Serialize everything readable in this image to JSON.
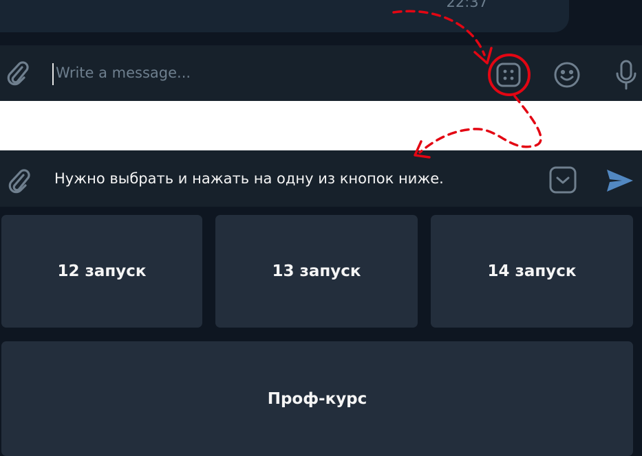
{
  "top": {
    "message_time": "22:37",
    "compose": {
      "placeholder": "Write a message..."
    },
    "icons": {
      "attach": "paperclip-icon",
      "keyboard": "bot-keyboard-icon",
      "emoji": "smile-icon",
      "mic": "microphone-icon"
    }
  },
  "bottom": {
    "reply_text": "Нужно выбрать и нажать на одну из кнопок ниже.",
    "icons": {
      "attach": "paperclip-icon",
      "hide_keyboard": "chevron-down-icon",
      "send": "send-icon"
    },
    "keyboard": {
      "buttons": [
        "12 запуск",
        "13 запуск",
        "14 запуск",
        "Проф-курс"
      ]
    }
  },
  "colors": {
    "background": "#0e1621",
    "bar": "#17212b",
    "button": "#232e3c",
    "icon": "#6f7f8e",
    "send": "#5288c1",
    "annotation": "#e30613"
  }
}
